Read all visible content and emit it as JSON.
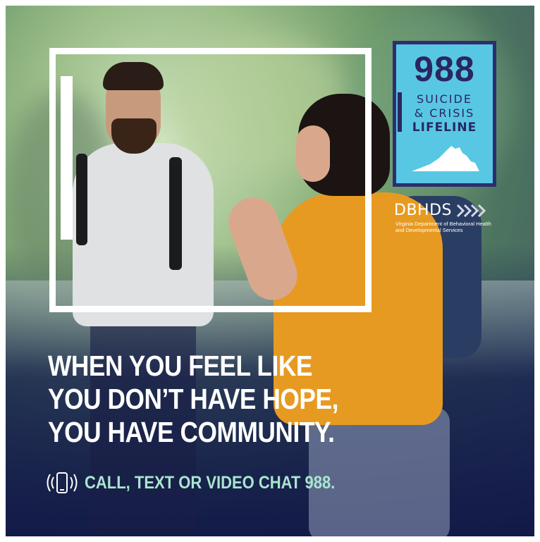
{
  "logo": {
    "number": "988",
    "line1": "SUICIDE",
    "line2": "& CRISIS",
    "line3": "LIFELINE",
    "color_bg": "#58c7e3",
    "color_text": "#2a2660"
  },
  "org": {
    "name": "DBHDS",
    "subtitle_line1": "Virginia Department of Behavioral Health",
    "subtitle_line2": "and Developmental Services"
  },
  "headline": {
    "line1": "WHEN YOU FEEL LIKE",
    "line2": "YOU DON’T HAVE HOPE,",
    "line3": "YOU HAVE COMMUNITY."
  },
  "cta": {
    "icon": "phone-signal-icon",
    "text": "CALL, TEXT OR VIDEO CHAT 988.",
    "color": "#a8e6cf"
  },
  "colors": {
    "headline": "#ffffff",
    "overlay_navy": "#12194e"
  }
}
